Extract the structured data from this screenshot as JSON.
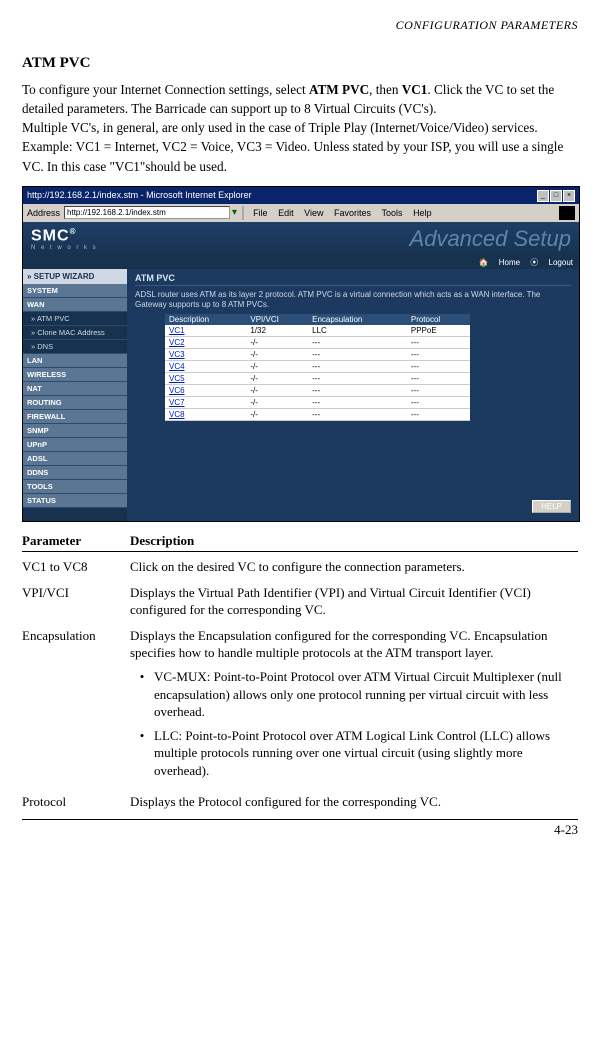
{
  "running_head": "CONFIGURATION PARAMETERS",
  "section_title": "ATM PVC",
  "intro": {
    "p1_a": "To configure your Internet Connection settings, select ",
    "p1_b1": "ATM PVC",
    "p1_c": ", then ",
    "p1_b2": "VC1",
    "p1_d": ". Click the VC to set the detailed parameters. The Barricade can support up to 8 Virtual Circuits (VC's).",
    "p2": "Multiple VC's, in general, are only used in the case of Triple Play (Internet/Voice/Video) services. Example: VC1 = Internet, VC2 = Voice, VC3 = Video. Unless stated by your ISP, you will use a single VC. In this case \"VC1\"should be used."
  },
  "screenshot": {
    "window_title": "http://192.168.2.1/index.stm - Microsoft Internet Explorer",
    "addr_label": "Address",
    "addr_value": "http://192.168.2.1/index.stm",
    "menu": [
      "File",
      "Edit",
      "View",
      "Favorites",
      "Tools",
      "Help"
    ],
    "logo": "SMC",
    "logo_sub": "N e t w o r k s",
    "adv": "Advanced Setup",
    "home": "Home",
    "logout": "Logout",
    "wizard": "» SETUP WIZARD",
    "nav": [
      "SYSTEM",
      "WAN",
      "» ATM PVC",
      "» Clone MAC Address",
      "» DNS",
      "LAN",
      "WIRELESS",
      "NAT",
      "ROUTING",
      "FIREWALL",
      "SNMP",
      "UPnP",
      "ADSL",
      "DDNS",
      "TOOLS",
      "STATUS"
    ],
    "box_title": "ATM PVC",
    "box_desc": "ADSL router uses ATM as its layer 2 protocol. ATM PVC is a virtual connection which acts as a WAN interface. The Gateway supports up to 8 ATM PVCs.",
    "cols": [
      "Description",
      "VPI/VCI",
      "Encapsulation",
      "Protocol"
    ],
    "rows": [
      {
        "desc": "VC1",
        "vpivci": "1/32",
        "encap": "LLC",
        "proto": "PPPoE"
      },
      {
        "desc": "VC2",
        "vpivci": "-/-",
        "encap": "---",
        "proto": "---"
      },
      {
        "desc": "VC3",
        "vpivci": "-/-",
        "encap": "---",
        "proto": "---"
      },
      {
        "desc": "VC4",
        "vpivci": "-/-",
        "encap": "---",
        "proto": "---"
      },
      {
        "desc": "VC5",
        "vpivci": "-/-",
        "encap": "---",
        "proto": "---"
      },
      {
        "desc": "VC6",
        "vpivci": "-/-",
        "encap": "---",
        "proto": "---"
      },
      {
        "desc": "VC7",
        "vpivci": "-/-",
        "encap": "---",
        "proto": "---"
      },
      {
        "desc": "VC8",
        "vpivci": "-/-",
        "encap": "---",
        "proto": "---"
      }
    ],
    "help": "HELP"
  },
  "param_header": {
    "c1": "Parameter",
    "c2": "Description"
  },
  "params": [
    {
      "name": "VC1 to VC8",
      "desc": "Click on the desired VC to configure the connection parameters."
    },
    {
      "name": "VPI/VCI",
      "desc": "Displays the Virtual Path Identifier (VPI) and Virtual Circuit Identifier (VCI) configured for the corresponding VC."
    },
    {
      "name": "Encapsulation",
      "desc": "Displays the Encapsulation configured for the corresponding VC. Encapsulation specifies how to handle multiple protocols at the ATM transport layer.",
      "bullets": [
        "VC-MUX: Point-to-Point Protocol over ATM Virtual Circuit Multiplexer (null encapsulation) allows only one protocol running per virtual circuit with less overhead.",
        "LLC: Point-to-Point Protocol over ATM Logical Link Control (LLC) allows multiple protocols running over one virtual circuit (using slightly more overhead)."
      ]
    },
    {
      "name": "Protocol",
      "desc": "Displays the Protocol configured for the corresponding VC."
    }
  ],
  "page_number": "4-23"
}
